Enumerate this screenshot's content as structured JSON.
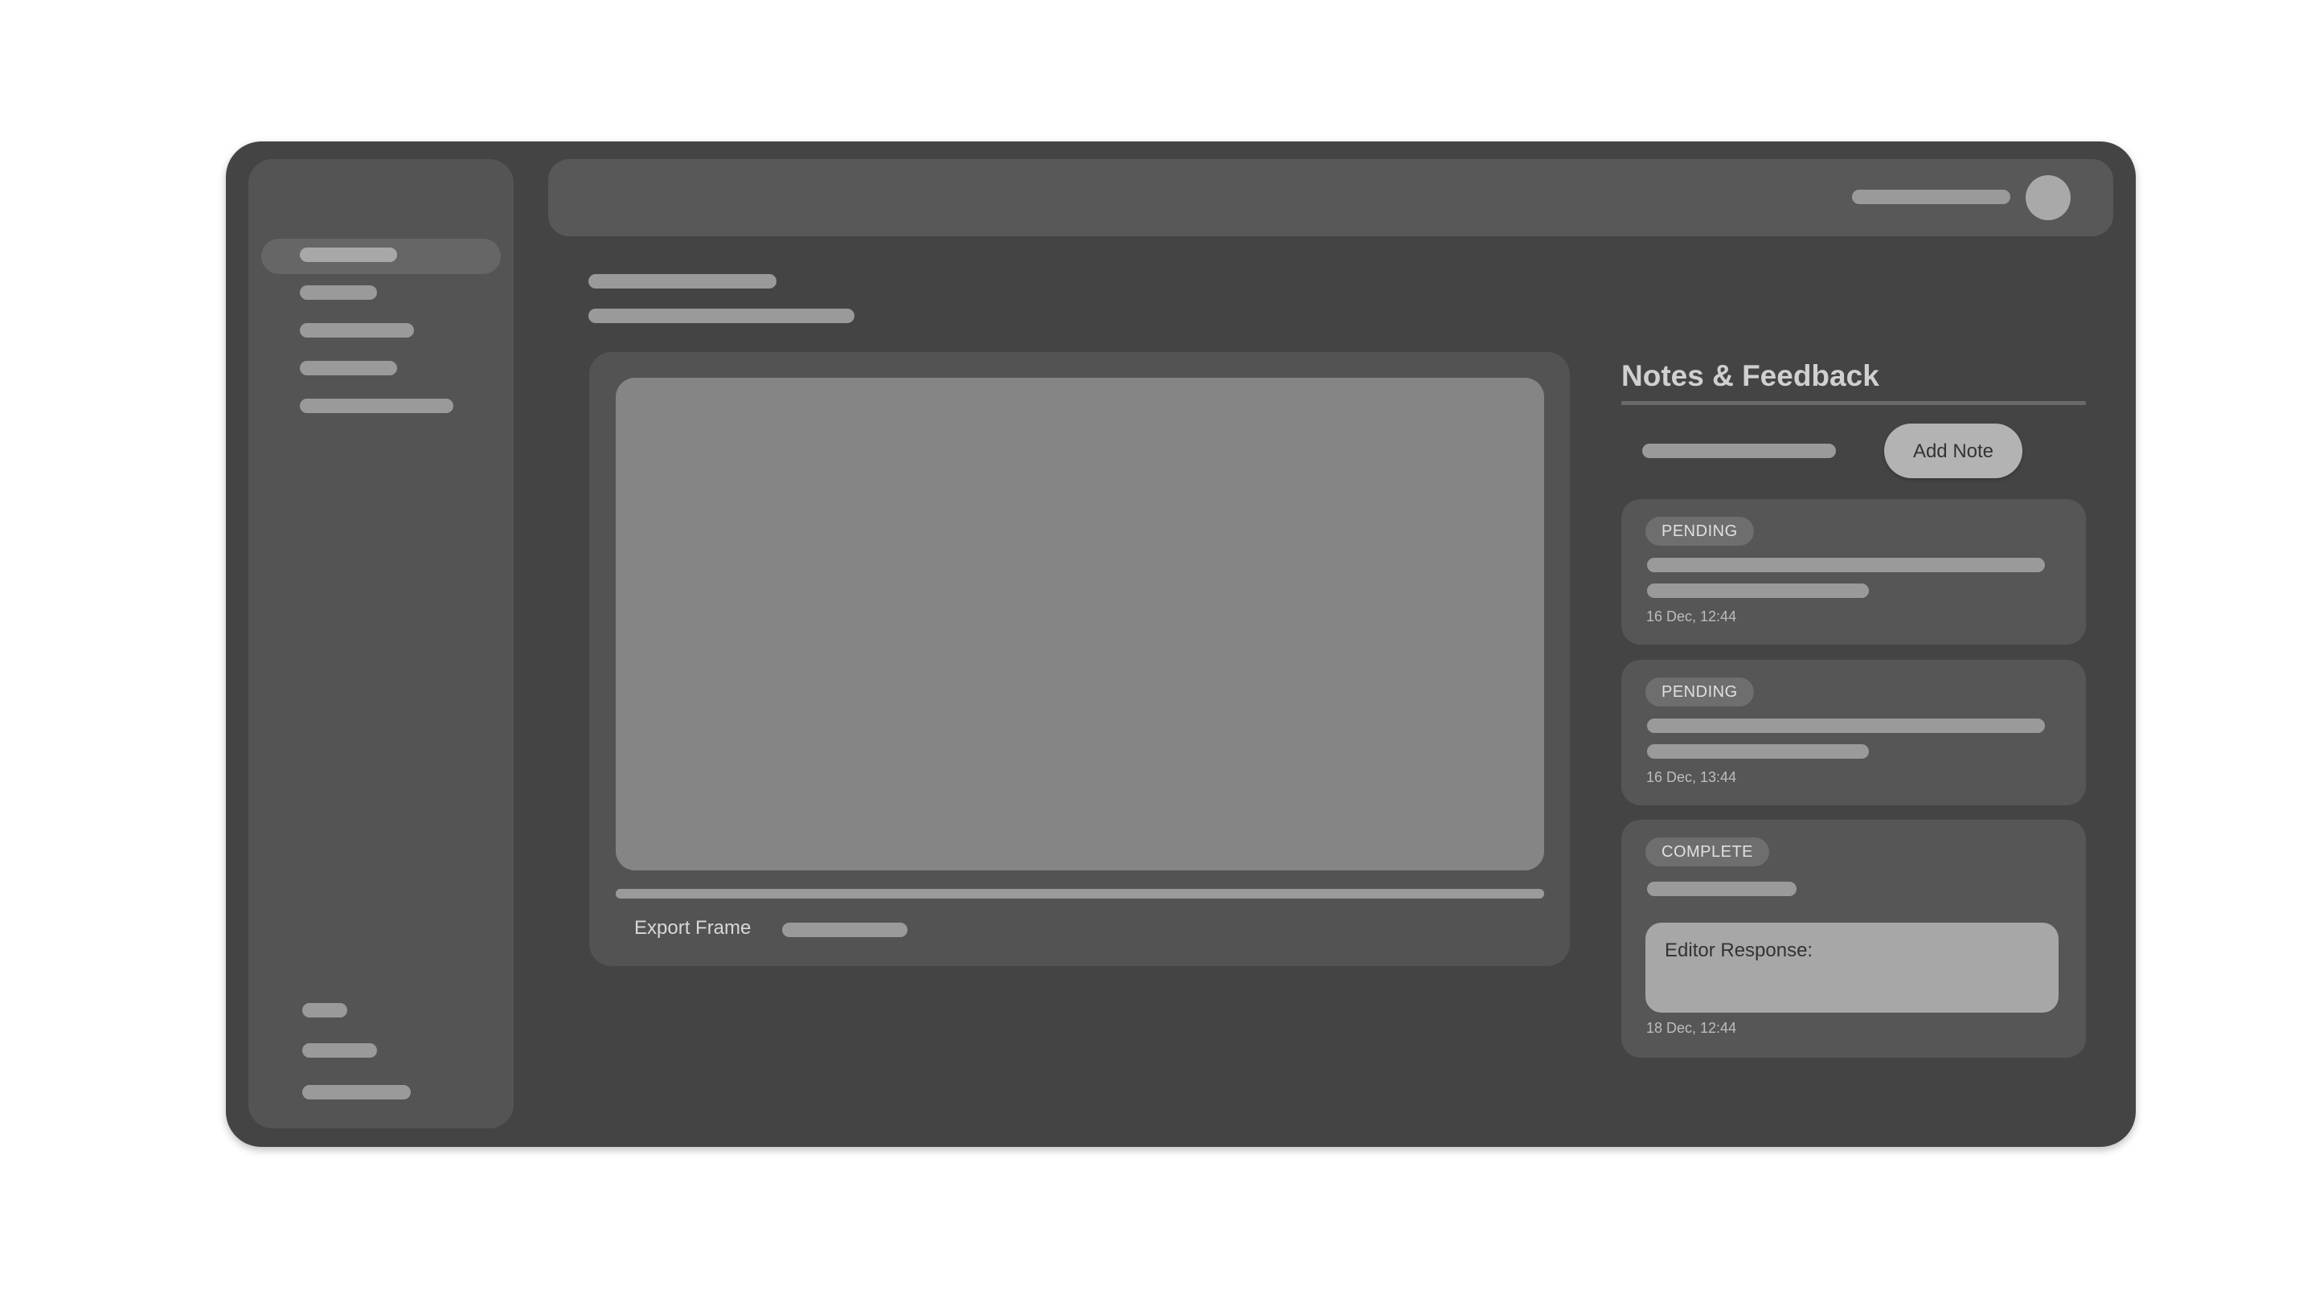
{
  "sidebar": {
    "active_index": 0,
    "top_items": [
      "nav-item-1",
      "nav-item-2",
      "nav-item-3",
      "nav-item-4",
      "nav-item-5"
    ],
    "bottom_items": [
      "bottom-item-1",
      "bottom-item-2",
      "bottom-item-3"
    ]
  },
  "topbar": {
    "avatar_icon": "user-avatar-icon"
  },
  "player": {
    "progress_fraction": 1.0,
    "export_label": "Export Frame"
  },
  "notes": {
    "title": "Notes & Feedback",
    "add_note_label": "Add Note",
    "items": [
      {
        "status": "PENDING",
        "timestamp": "16 Dec, 12:44"
      },
      {
        "status": "PENDING",
        "timestamp": "16 Dec, 13:44"
      },
      {
        "status": "COMPLETE",
        "editor_response_label": "Editor Response:",
        "timestamp": "18 Dec, 12:44"
      }
    ]
  },
  "colors": {
    "window_bg": "#444444",
    "panel_bg": "#545454",
    "video_bg": "#858585",
    "button_bg": "#b3b3b3"
  }
}
